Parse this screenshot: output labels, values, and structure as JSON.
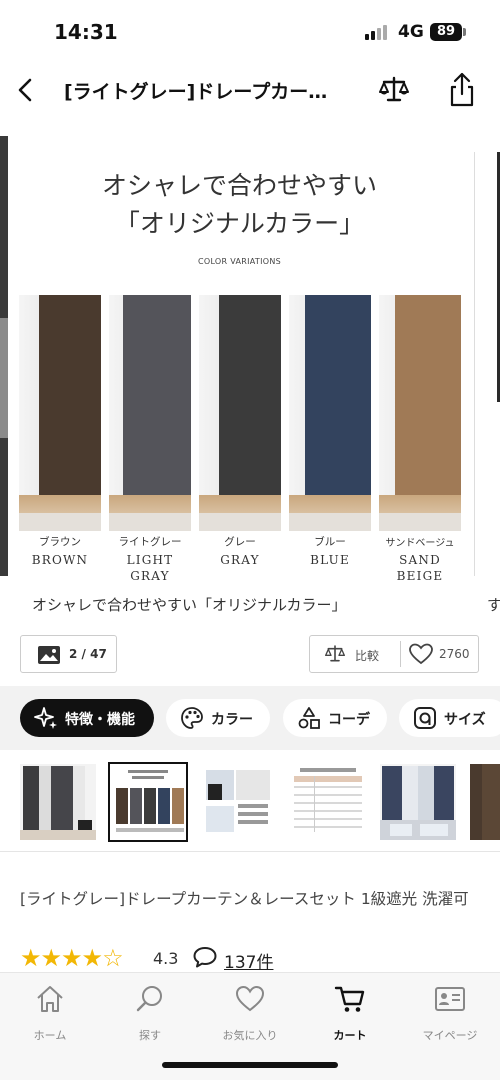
{
  "status_bar": {
    "time": "14:31",
    "network": "4G",
    "battery": "89"
  },
  "nav": {
    "title": "[ライトグレー]ドレープカー…",
    "icons": [
      "back-icon",
      "scale-icon",
      "share-icon"
    ]
  },
  "hero": {
    "heading_line1": "オシャレで合わせやすい",
    "heading_line2": "「オリジナルカラー」",
    "subheading": "COLOR VARIATIONS",
    "colors": [
      {
        "jp": "ブラウン",
        "en_line1": "BROWN",
        "en_line2": "",
        "panel": "#4a3a2e"
      },
      {
        "jp": "ライトグレー",
        "en_line1": "LIGHT",
        "en_line2": "GRAY",
        "panel": "#54545a"
      },
      {
        "jp": "グレー",
        "en_line1": "GRAY",
        "en_line2": "",
        "panel": "#3b3b3b"
      },
      {
        "jp": "ブルー",
        "en_line1": "BLUE",
        "en_line2": "",
        "panel": "#33435e"
      },
      {
        "jp": "サンドベージュ",
        "en_line1": "SAND",
        "en_line2": "BEIGE",
        "panel": "#a07a56"
      }
    ]
  },
  "caption": {
    "text": "オシャレで合わせやすい「オリジナルカラー」",
    "next_peek": "す"
  },
  "actions": {
    "image_counter": "2 / 47",
    "compare_label": "比較",
    "favorite_count": "2760"
  },
  "feature_tabs": [
    {
      "label": "特徴・機能",
      "icon": "sparkle-icon",
      "active": true
    },
    {
      "label": "カラー",
      "icon": "palette-icon",
      "active": false
    },
    {
      "label": "コーデ",
      "icon": "shapes-icon",
      "active": false
    },
    {
      "label": "サイズ",
      "icon": "ruler-icon",
      "active": false
    }
  ],
  "product": {
    "name": "[ライトグレー]ドレープカーテン＆レースセット 1級遮光 洗濯可",
    "stars": "★★★★☆",
    "rating": "4.3",
    "review_count": "137件"
  },
  "bottom_tabs": [
    {
      "label": "ホーム",
      "icon": "home-icon",
      "active": false
    },
    {
      "label": "探す",
      "icon": "search-icon",
      "active": false
    },
    {
      "label": "お気に入り",
      "icon": "heart-icon",
      "active": false
    },
    {
      "label": "カート",
      "icon": "cart-icon",
      "active": true
    },
    {
      "label": "マイページ",
      "icon": "id-card-icon",
      "active": false
    }
  ],
  "colors": {
    "accent_star": "#f2b705",
    "active_chip": "#111111",
    "chip_band": "#f2f2f2"
  }
}
